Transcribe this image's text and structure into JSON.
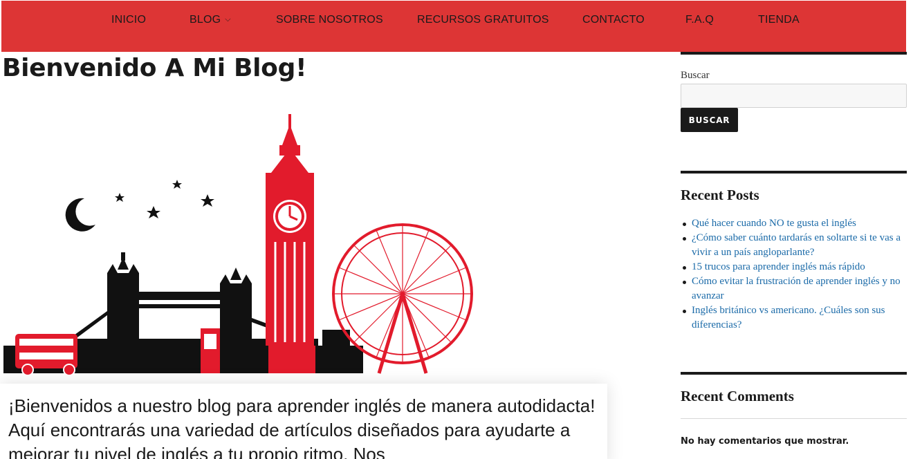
{
  "nav": {
    "items": [
      {
        "label": "INICIO"
      },
      {
        "label": "BLOG",
        "has_dropdown": true
      },
      {
        "label": "SOBRE NOSOTROS"
      },
      {
        "label": "RECURSOS GRATUITOS"
      },
      {
        "label": "CONTACTO"
      },
      {
        "label": "F.A.Q"
      },
      {
        "label": "TIENDA"
      }
    ],
    "background_color": "#dd3535"
  },
  "main": {
    "title": "Bienvenido A Mi Blog!",
    "hero_illustration": "london-skyline-icon",
    "intro": "¡Bienvenidos a nuestro blog para aprender inglés de manera autodidacta! Aquí encontrarás una variedad de artículos diseñados para ayudarte a mejorar tu nivel de inglés a tu propio ritmo. Nos"
  },
  "sidebar": {
    "search": {
      "label": "Buscar",
      "value": "",
      "button_label": "BUSCAR"
    },
    "recent_posts": {
      "title": "Recent Posts",
      "items": [
        {
          "label": "Qué hacer cuando NO te gusta el inglés"
        },
        {
          "label": "¿Cómo saber cuánto tardarás en soltarte si te vas a vivir a un país angloparlante?"
        },
        {
          "label": "15 trucos para aprender inglés más rápido"
        },
        {
          "label": "Cómo evitar la frustración de aprender inglés y no avanzar"
        },
        {
          "label": "Inglés británico vs americano. ¿Cuáles son sus diferencias?"
        }
      ],
      "link_color": "#1a6aa8"
    },
    "recent_comments": {
      "title": "Recent Comments",
      "empty_text": "No hay comentarios que mostrar."
    }
  }
}
